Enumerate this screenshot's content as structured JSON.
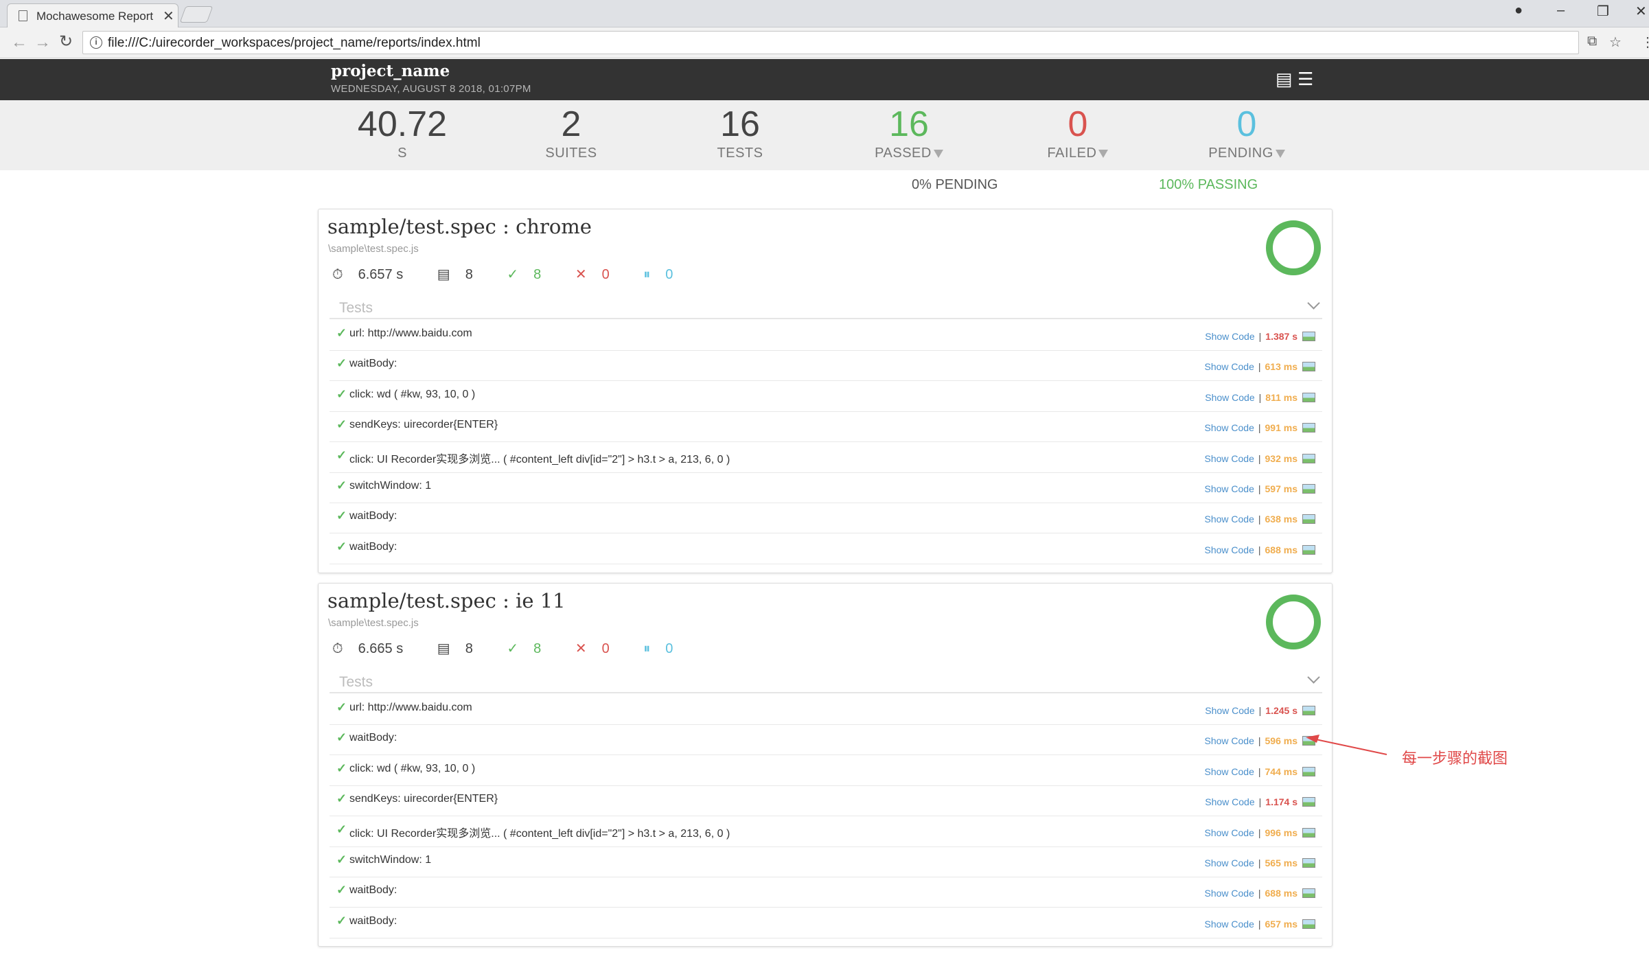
{
  "browser": {
    "tab_title": "Mochawesome Report",
    "tab_close": "✕",
    "url": "file:///C:/uirecorder_workspaces/project_name/reports/index.html"
  },
  "report": {
    "project_name": "project_name",
    "date": "WEDNESDAY, AUGUST 8 2018, 01:07PM",
    "stats": {
      "duration": {
        "value": "40.72",
        "label": "S"
      },
      "suites": {
        "value": "2",
        "label": "SUITES"
      },
      "tests": {
        "value": "16",
        "label": "TESTS"
      },
      "passed": {
        "value": "16",
        "label": "PASSED"
      },
      "failed": {
        "value": "0",
        "label": "FAILED"
      },
      "pending": {
        "value": "0",
        "label": "PENDING"
      }
    },
    "pending_percent": "0% PENDING",
    "passing_percent": "100% PASSING",
    "tests_header": "Tests",
    "show_code": "Show Code"
  },
  "suites": [
    {
      "title": "sample/test.spec : chrome",
      "file": "\\sample\\test.spec.js",
      "duration": "6.657 s",
      "tests": "8",
      "passed": "8",
      "failed": "0",
      "pending": "0",
      "rows": [
        {
          "title": "url: http://www.baidu.com",
          "duration": "1.387 s",
          "slow": true
        },
        {
          "title": "waitBody:",
          "duration": "613 ms",
          "slow": false
        },
        {
          "title": "click: wd ( #kw, 93, 10, 0 )",
          "duration": "811 ms",
          "slow": false
        },
        {
          "title": "sendKeys: uirecorder{ENTER}",
          "duration": "991 ms",
          "slow": false
        },
        {
          "title": "click: UI Recorder实现多浏览... ( #content_left div[id=\"2\"] > h3.t > a, 213, 6, 0 )",
          "duration": "932 ms",
          "slow": false
        },
        {
          "title": "switchWindow: 1",
          "duration": "597 ms",
          "slow": false
        },
        {
          "title": "waitBody:",
          "duration": "638 ms",
          "slow": false
        },
        {
          "title": "waitBody:",
          "duration": "688 ms",
          "slow": false
        }
      ]
    },
    {
      "title": "sample/test.spec : ie 11",
      "file": "\\sample\\test.spec.js",
      "duration": "6.665 s",
      "tests": "8",
      "passed": "8",
      "failed": "0",
      "pending": "0",
      "rows": [
        {
          "title": "url: http://www.baidu.com",
          "duration": "1.245 s",
          "slow": true
        },
        {
          "title": "waitBody:",
          "duration": "596 ms",
          "slow": false
        },
        {
          "title": "click: wd ( #kw, 93, 10, 0 )",
          "duration": "744 ms",
          "slow": false
        },
        {
          "title": "sendKeys: uirecorder{ENTER}",
          "duration": "1.174 s",
          "slow": true
        },
        {
          "title": "click: UI Recorder实现多浏览... ( #content_left div[id=\"2\"] > h3.t > a, 213, 6, 0 )",
          "duration": "996 ms",
          "slow": false
        },
        {
          "title": "switchWindow: 1",
          "duration": "565 ms",
          "slow": false
        },
        {
          "title": "waitBody:",
          "duration": "688 ms",
          "slow": false
        },
        {
          "title": "waitBody:",
          "duration": "657 ms",
          "slow": false
        }
      ]
    }
  ],
  "annotation": {
    "text": "每一步骤的截图"
  },
  "colors": {
    "passed": "#5cb85c",
    "failed": "#d9534f",
    "pending": "#5bc0de",
    "nav": "#333333",
    "annotation": "#e04848"
  },
  "icons": [
    "page-icon",
    "back-icon",
    "forward-icon",
    "reload-icon",
    "info-icon",
    "translate-icon",
    "star-icon",
    "menu-icon",
    "timer-icon",
    "test-count-icon",
    "check-icon",
    "cross-icon",
    "pause-icon",
    "image-icon",
    "chevron-down-icon"
  ]
}
